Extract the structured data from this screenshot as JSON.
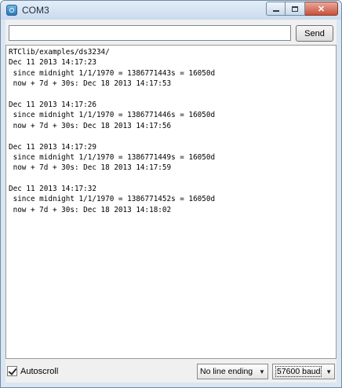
{
  "window": {
    "title": "COM3"
  },
  "input": {
    "value": "",
    "send_label": "Send"
  },
  "output_lines": [
    "RTClib/examples/ds3234/",
    "Dec 11 2013 14:17:23",
    " since midnight 1/1/1970 = 1386771443s = 16050d",
    " now + 7d + 30s: Dec 18 2013 14:17:53",
    "",
    "Dec 11 2013 14:17:26",
    " since midnight 1/1/1970 = 1386771446s = 16050d",
    " now + 7d + 30s: Dec 18 2013 14:17:56",
    "",
    "Dec 11 2013 14:17:29",
    " since midnight 1/1/1970 = 1386771449s = 16050d",
    " now + 7d + 30s: Dec 18 2013 14:17:59",
    "",
    "Dec 11 2013 14:17:32",
    " since midnight 1/1/1970 = 1386771452s = 16050d",
    " now + 7d + 30s: Dec 18 2013 14:18:02"
  ],
  "status": {
    "autoscroll_label": "Autoscroll",
    "autoscroll_checked": true,
    "line_ending": "No line ending",
    "baud": "57600 baud"
  },
  "icons": {
    "app": "serial-monitor-icon",
    "minimize": "minimize-icon",
    "maximize": "maximize-icon",
    "close": "close-icon",
    "dropdown": "chevron-down-icon"
  }
}
